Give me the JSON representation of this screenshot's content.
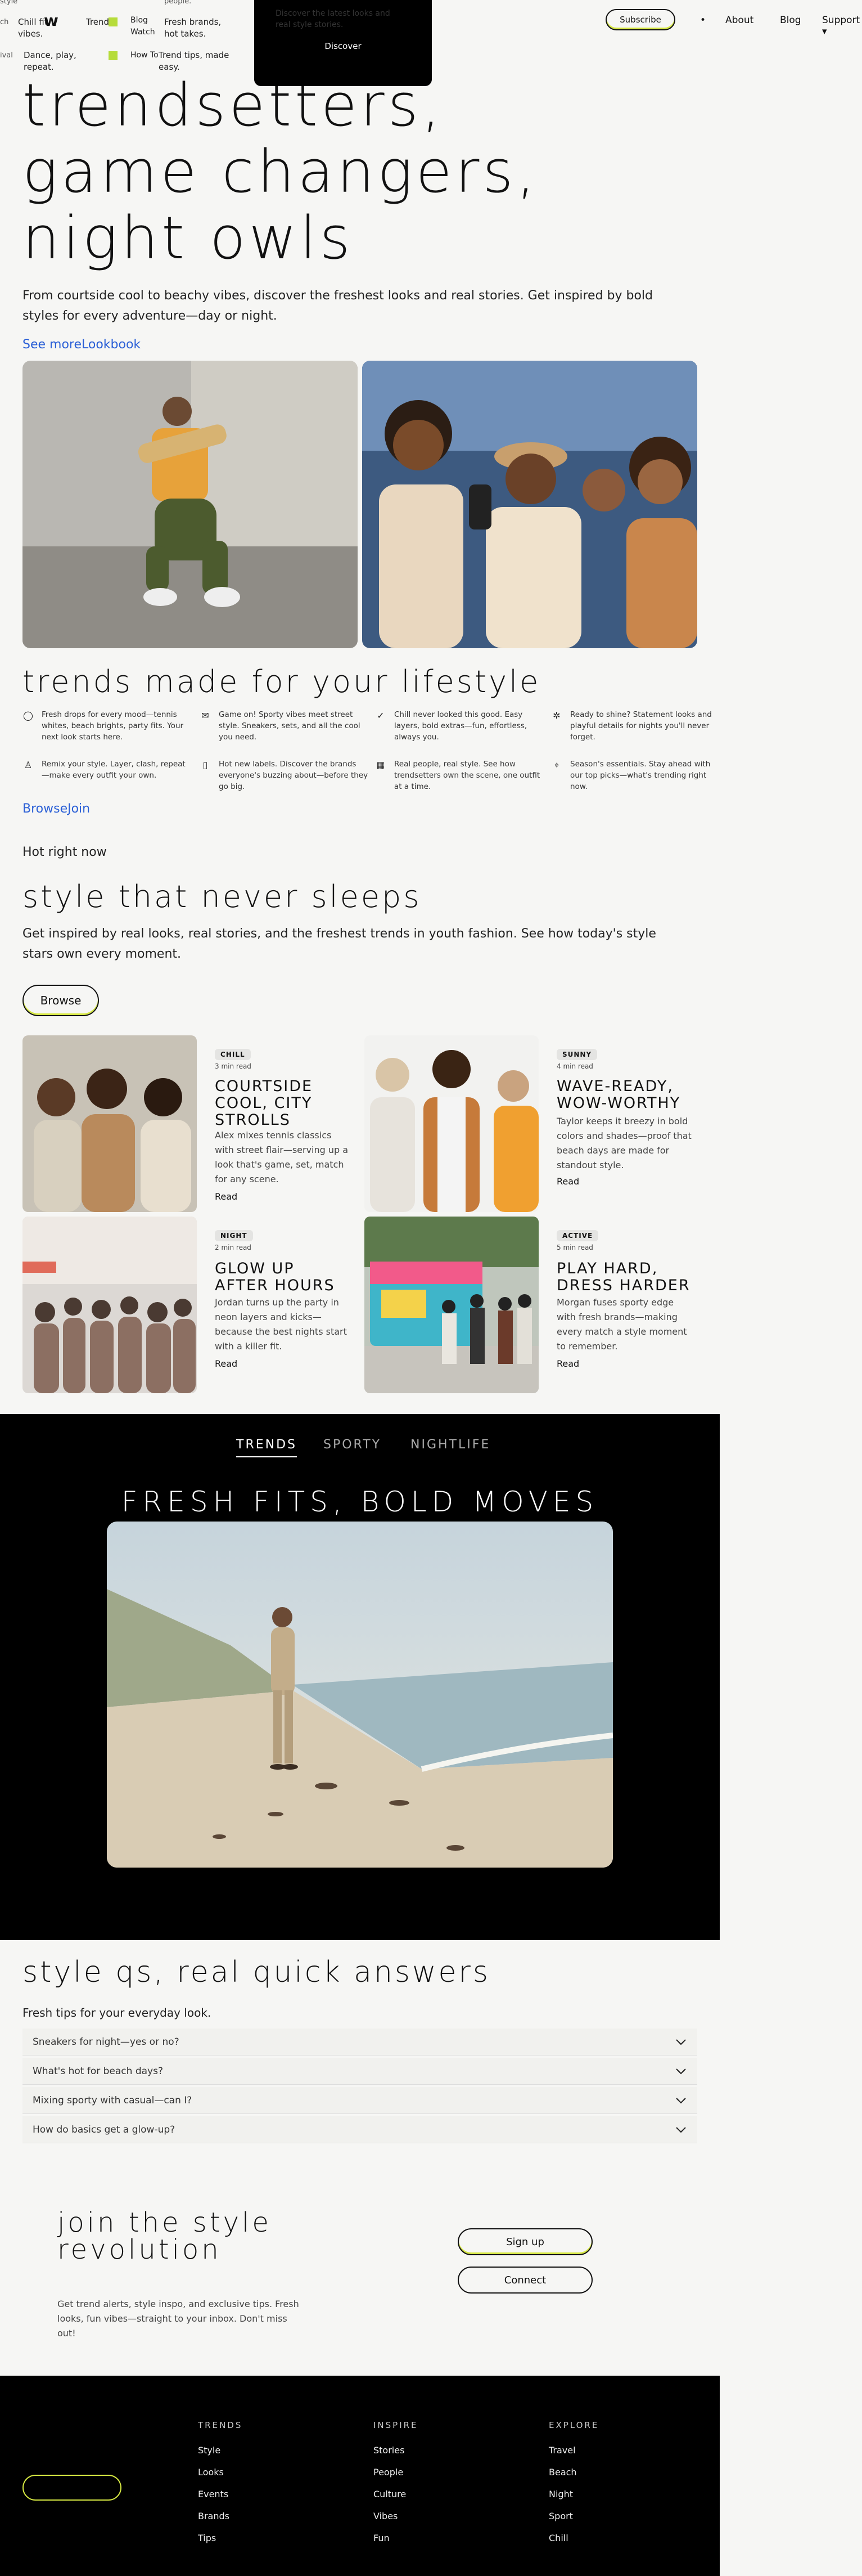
{
  "nav": {
    "logo": "w",
    "mini_items": [
      {
        "label": "Chill fit vibes."
      },
      {
        "label": "Dance, play, repeat."
      },
      {
        "label": "Trend"
      },
      {
        "label": "Blog Watch"
      },
      {
        "label": "How To"
      },
      {
        "label": "Fresh brands, hot takes."
      },
      {
        "label": "Trend tips, made easy."
      }
    ],
    "cut_top_left": "ch",
    "cut_bottom_left": "ival",
    "cut_style": "style",
    "cut_people": "people.",
    "dropdown_ghost": "Discover the latest looks and real style stories.",
    "dropdown_button": "Discover",
    "subscribe": "Subscribe",
    "dot": "•",
    "about": "About",
    "blog": "Blog",
    "support": "Support",
    "support_caret": "▾"
  },
  "hero": {
    "title_lines": [
      "Trendsetters,",
      "game changers,",
      "night owls"
    ],
    "subtitle": "From courtside cool to beachy vibes, discover the freshest looks and real stories. Get inspired by bold styles for every adventure—day or night.",
    "link_see_more": "See more",
    "link_lookbook": "Lookbook"
  },
  "lifestyle": {
    "title": "Trends made for your lifestyle",
    "features": [
      {
        "icon": "chat-icon",
        "glyph": "◯",
        "text": "Fresh drops for every mood—tennis whites, beach brights, party fits. Your next look starts here."
      },
      {
        "icon": "mail-icon",
        "glyph": "✉",
        "text": "Game on! Sporty vibes meet street style. Sneakers, sets, and all the cool you need."
      },
      {
        "icon": "check-circle-icon",
        "glyph": "✓",
        "text": "Chill never looked this good. Easy layers, bold extras—fun, effortless, always you."
      },
      {
        "icon": "gear-icon",
        "glyph": "✲",
        "text": "Ready to shine? Statement looks and playful details for nights you'll never forget."
      },
      {
        "icon": "user-icon",
        "glyph": "♙",
        "text": "Remix your style. Layer, clash, repeat—make every outfit your own."
      },
      {
        "icon": "document-icon",
        "glyph": "▯",
        "text": "Hot new labels. Discover the brands everyone's buzzing about—before they go big."
      },
      {
        "icon": "calendar-icon",
        "glyph": "▦",
        "text": "Real people, real style. See how trendsetters own the scene, one outfit at a time."
      },
      {
        "icon": "location-icon",
        "glyph": "⌖",
        "text": "Season's essentials. Stay ahead with our top picks—what's trending right now."
      }
    ],
    "link_browse": "Browse",
    "link_join": "Join"
  },
  "hot": {
    "kicker": "Hot right now",
    "title": "Style that never sleeps",
    "subtitle": "Get inspired by real looks, real stories, and the freshest trends in youth fashion. See how today's style stars own every moment.",
    "browse": "Browse"
  },
  "cards": [
    {
      "tag": "CHILL",
      "meta": "3 min read",
      "title": "Courtside cool, city strolls",
      "text": "Alex mixes tennis classics with street flair—serving up a look that's game, set, match for any scene.",
      "read": "Read"
    },
    {
      "tag": "SUNNY",
      "meta": "4 min read",
      "title": "Wave-ready, wow-worthy",
      "text": "Taylor keeps it breezy in bold colors and shades—proof that beach days are made for standout style.",
      "read": "Read"
    },
    {
      "tag": "NIGHT",
      "meta": "2 min read",
      "title": "Glow up after hours",
      "text": "Jordan turns up the party in neon layers and kicks—because the best nights start with a killer fit.",
      "read": "Read"
    },
    {
      "tag": "ACTIVE",
      "meta": "5 min read",
      "title": "Play hard, dress harder",
      "text": "Morgan fuses sporty edge with fresh brands—making every match a style moment to remember.",
      "read": "Read"
    }
  ],
  "tabs": {
    "items": [
      "TRENDS",
      "SPORTY",
      "NIGHTLIFE"
    ],
    "active": "TRENDS",
    "headline": "Fresh fits, bold moves"
  },
  "faq": {
    "title": "Style Qs, real quick answers",
    "subtitle": "Fresh tips for your everyday look.",
    "items": [
      "Sneakers for night—yes or no?",
      "What's hot for beach days?",
      "Mixing sporty with casual—can I?",
      "How do basics get a glow-up?"
    ]
  },
  "join": {
    "title_lines": [
      "Join the style",
      "revolution"
    ],
    "text": "Get trend alerts, style inspo, and exclusive tips. Fresh looks, fun vibes—straight to your inbox. Don't miss out!",
    "sign_up": "Sign up",
    "connect": "Connect"
  },
  "footer": {
    "cols": [
      {
        "heading": "TRENDS",
        "items": [
          "Style",
          "Looks",
          "Events",
          "Brands",
          "Tips"
        ]
      },
      {
        "heading": "INSPIRE",
        "items": [
          "Stories",
          "People",
          "Culture",
          "Vibes",
          "Fun"
        ]
      },
      {
        "heading": "EXPLORE",
        "items": [
          "Travel",
          "Beach",
          "Night",
          "Sport",
          "Chill"
        ]
      }
    ]
  },
  "colors": {
    "accent": "#d6e842",
    "link": "#2a5fd6",
    "dark": "#000000",
    "bg": "#f6f6f4"
  }
}
